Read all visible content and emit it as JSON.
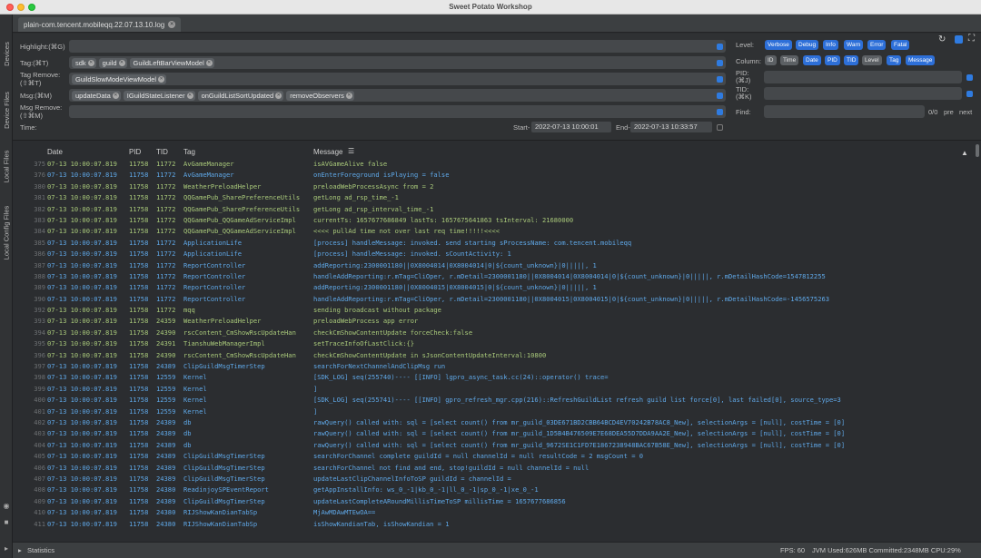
{
  "window": {
    "title": "Sweet Potato Workshop"
  },
  "sidebar": {
    "tabs": [
      "Devices",
      "Device Files",
      "Local Files",
      "Local Config Files"
    ]
  },
  "tab": {
    "label": "plain-com.tencent.mobileqq.22.07.13.10.log"
  },
  "filters": {
    "highlight_label": "Highlight:(⌘G)",
    "tag_label": "Tag:(⌘T)",
    "tag_remove_label": "Tag Remove:\n(⇧⌘T)",
    "msg_label": "Msg:(⌘M)",
    "msg_remove_label": "Msg Remove:\n(⇧⌘M)",
    "time_label": "Time:",
    "tags": [
      "sdk",
      "guild",
      "GuildLeftBarViewModel"
    ],
    "tag_remove": [
      "GuildSlowModeViewModel"
    ],
    "msgs": [
      "updateData",
      "IGuildStateListener",
      "onGuildListSortUpdated",
      "removeObservers"
    ],
    "start_label": "Start-",
    "start_value": "2022-07-13 10:00:01",
    "end_label": "End-",
    "end_value": "2022-07-13 10:33:57"
  },
  "right_panel": {
    "level_label": "Level:",
    "levels": [
      "Verbose",
      "Debug",
      "Info",
      "Warn",
      "Error",
      "Fatal"
    ],
    "column_label": "Column:",
    "columns": [
      "ID",
      "Time",
      "Date",
      "PID",
      "TID",
      "Level",
      "Tag",
      "Message"
    ],
    "pid_label": "PID:\n(⌘J)",
    "tid_label": "TID:\n(⌘K)",
    "find_label": "Find:",
    "find_count": "0/0",
    "prev_label": "pre",
    "next_label": "next"
  },
  "log": {
    "headers": {
      "date": "Date",
      "pid": "PID",
      "tid": "TID",
      "tag": "Tag",
      "message": "Message"
    },
    "rows": [
      {
        "no": "375",
        "date": "07-13 10:00:07.819",
        "pid": "11758",
        "tid": "11772",
        "tag": "AvGameManager",
        "msg": "isAVGameAlive false",
        "lvl": "d"
      },
      {
        "no": "376",
        "date": "07-13 10:00:07.819",
        "pid": "11758",
        "tid": "11772",
        "tag": "AvGameManager",
        "msg": "onEnterForeground isPlaying = false",
        "lvl": "i"
      },
      {
        "no": "380",
        "date": "07-13 10:00:07.819",
        "pid": "11758",
        "tid": "11772",
        "tag": "WeatherPreloadHelper",
        "msg": "preloadWebProcessAsync from = 2",
        "lvl": "d"
      },
      {
        "no": "381",
        "date": "07-13 10:00:07.819",
        "pid": "11758",
        "tid": "11772",
        "tag": "QQGamePub_SharePreferenceUtils",
        "msg": "getLong ad_rsp_time_-1",
        "lvl": "d"
      },
      {
        "no": "382",
        "date": "07-13 10:00:07.819",
        "pid": "11758",
        "tid": "11772",
        "tag": "QQGamePub_SharePreferenceUtils",
        "msg": "getLong ad_rsp_interval_time_-1",
        "lvl": "d"
      },
      {
        "no": "383",
        "date": "07-13 10:00:07.819",
        "pid": "11758",
        "tid": "11772",
        "tag": "QQGamePub_QQGameAdServiceImpl",
        "msg": "currentTs: 1657677686849 lastTs: 1657675641863 tsInterval: 21680000",
        "lvl": "d"
      },
      {
        "no": "384",
        "date": "07-13 10:00:07.819",
        "pid": "11758",
        "tid": "11772",
        "tag": "QQGamePub_QQGameAdServiceImpl",
        "msg": "<<<< pullAd time not over last req time!!!!!<<<<",
        "lvl": "d"
      },
      {
        "no": "385",
        "date": "07-13 10:00:07.819",
        "pid": "11758",
        "tid": "11772",
        "tag": "ApplicationLife",
        "msg": "[process] handleMessage: invoked. send starting sProcessName: com.tencent.mobileqq",
        "lvl": "i"
      },
      {
        "no": "386",
        "date": "07-13 10:00:07.819",
        "pid": "11758",
        "tid": "11772",
        "tag": "ApplicationLife",
        "msg": "[process] handleMessage: invoked.  sCountActivity: 1",
        "lvl": "i"
      },
      {
        "no": "387",
        "date": "07-13 10:00:07.819",
        "pid": "11758",
        "tid": "11772",
        "tag": "ReportController",
        "msg": "addReporting:2300001180||0X8004014|0X8004014|0|${count_unknown}|0|||||, 1",
        "lvl": "i"
      },
      {
        "no": "388",
        "date": "07-13 10:00:07.819",
        "pid": "11758",
        "tid": "11772",
        "tag": "ReportController",
        "msg": "handleAddReporting:r.mTag=CliOper, r.mDetail=2300001180||0X8004014|0X8004014|0|${count_unknown}|0|||||, r.mDetailHashCode=1547812255",
        "lvl": "i"
      },
      {
        "no": "389",
        "date": "07-13 10:00:07.819",
        "pid": "11758",
        "tid": "11772",
        "tag": "ReportController",
        "msg": "addReporting:2300001180||0X8004015|0X8004015|0|${count_unknown}|0|||||, 1",
        "lvl": "i"
      },
      {
        "no": "390",
        "date": "07-13 10:00:07.819",
        "pid": "11758",
        "tid": "11772",
        "tag": "ReportController",
        "msg": "handleAddReporting:r.mTag=CliOper, r.mDetail=2300001180||0X8004015|0X8004015|0|${count_unknown}|0|||||, r.mDetailHashCode=-1456575263",
        "lvl": "i"
      },
      {
        "no": "392",
        "date": "07-13 10:00:07.819",
        "pid": "11758",
        "tid": "11772",
        "tag": "mqq",
        "msg": "sending broadcast without package",
        "lvl": "d"
      },
      {
        "no": "393",
        "date": "07-13 10:00:07.819",
        "pid": "11758",
        "tid": "24359",
        "tag": "WeatherPreloadHelper",
        "msg": "preloadWebProcess app error",
        "lvl": "d"
      },
      {
        "no": "394",
        "date": "07-13 10:00:07.819",
        "pid": "11758",
        "tid": "24390",
        "tag": "rscContent_CmShowRscUpdateHan",
        "msg": "checkCmShowContentUpdate forceCheck:false",
        "lvl": "d"
      },
      {
        "no": "395",
        "date": "07-13 10:00:07.819",
        "pid": "11758",
        "tid": "24391",
        "tag": "TianshuWebManagerImpl",
        "msg": "setTraceInfoOfLastClick:{}",
        "lvl": "d"
      },
      {
        "no": "396",
        "date": "07-13 10:00:07.819",
        "pid": "11758",
        "tid": "24390",
        "tag": "rscContent_CmShowRscUpdateHan",
        "msg": "checkCmShowContentUpdate in sJsonContentUpdateInterval:10800",
        "lvl": "d"
      },
      {
        "no": "397",
        "date": "07-13 10:00:07.819",
        "pid": "11758",
        "tid": "24389",
        "tag": "ClipGuildMsgTimerStep",
        "msg": "searchForNextChannelAndClipMsg run",
        "lvl": "i"
      },
      {
        "no": "398",
        "date": "07-13 10:00:07.819",
        "pid": "11758",
        "tid": "12559",
        "tag": "Kernel",
        "msg": "[SDK_LOG] seq(255740)---- [[INFO] lgpro_async_task.cc(24)::operator() trace=",
        "lvl": "i"
      },
      {
        "no": "399",
        "date": "07-13 10:00:07.819",
        "pid": "11758",
        "tid": "12559",
        "tag": "Kernel",
        "msg": "]",
        "lvl": "i"
      },
      {
        "no": "400",
        "date": "07-13 10:00:07.819",
        "pid": "11758",
        "tid": "12559",
        "tag": "Kernel",
        "msg": "[SDK_LOG] seq(255741)---- [[INFO] gpro_refresh_mgr.cpp(216)::RefreshGuildList refresh guild list force[0], last failed[0], source_type=3",
        "lvl": "i"
      },
      {
        "no": "401",
        "date": "07-13 10:00:07.819",
        "pid": "11758",
        "tid": "12559",
        "tag": "Kernel",
        "msg": "]",
        "lvl": "i"
      },
      {
        "no": "402",
        "date": "07-13 10:00:07.819",
        "pid": "11758",
        "tid": "24389",
        "tag": "db",
        "msg": "rawQuery() called with: sql = [select count() from mr_guild_03DE671BD2CBB64BCD4EV70242B78AC8_New], selectionArgs = [null], costTime = [0]",
        "lvl": "i"
      },
      {
        "no": "403",
        "date": "07-13 10:00:07.819",
        "pid": "11758",
        "tid": "24389",
        "tag": "db",
        "msg": "rawQuery() called with: sql = [select count() from mr_guild_1D5B4B476509E7E68DEA55D7DDA9AA2E_New], selectionArgs = [null], costTime = [0]",
        "lvl": "i"
      },
      {
        "no": "404",
        "date": "07-13 10:00:07.819",
        "pid": "11758",
        "tid": "24389",
        "tag": "db",
        "msg": "rawQuery() called with: sql = [select count() from mr_guild_9672SE1C1FD7E1867238948BAC67B58E_New], selectionArgs = [null], costTime = [0]",
        "lvl": "i"
      },
      {
        "no": "405",
        "date": "07-13 10:00:07.819",
        "pid": "11758",
        "tid": "24389",
        "tag": "ClipGuildMsgTimerStep",
        "msg": "searchForChannel complete guildId = null channelId = null resultCode = 2 msgCount = 0",
        "lvl": "i"
      },
      {
        "no": "406",
        "date": "07-13 10:00:07.819",
        "pid": "11758",
        "tid": "24389",
        "tag": "ClipGuildMsgTimerStep",
        "msg": "searchForChannel not find and end, stop!guildId = null channelId = null",
        "lvl": "i"
      },
      {
        "no": "407",
        "date": "07-13 10:00:07.819",
        "pid": "11758",
        "tid": "24389",
        "tag": "ClipGuildMsgTimerStep",
        "msg": "updateLastClipChannelInfoToSP guildId =  channelId =",
        "lvl": "i"
      },
      {
        "no": "408",
        "date": "07-13 10:00:07.819",
        "pid": "11758",
        "tid": "24380",
        "tag": "ReadinjoySPEventReport",
        "msg": "getAppInstallInfo: ws_0_-1|kb_0_-1|ll_0_-1|sp_0_-1|xe_0_-1",
        "lvl": "i"
      },
      {
        "no": "409",
        "date": "07-13 10:00:07.819",
        "pid": "11758",
        "tid": "24389",
        "tag": "ClipGuildMsgTimerStep",
        "msg": "updateLastCompleteARoundMillisTimeToSP millisTime = 1657677686856",
        "lvl": "i"
      },
      {
        "no": "410",
        "date": "07-13 10:00:07.819",
        "pid": "11758",
        "tid": "24380",
        "tag": "RIJShowKanDianTabSp",
        "msg": "MjAwMDAwMTEwOA==",
        "lvl": "i"
      },
      {
        "no": "411",
        "date": "07-13 10:00:07.819",
        "pid": "11758",
        "tid": "24380",
        "tag": "RIJShowKanDianTabSp",
        "msg": " isShowKandianTab, isShowKandian = 1",
        "lvl": "i"
      }
    ]
  },
  "status": {
    "statistics_label": "Statistics",
    "fps": "FPS: 60",
    "jvm": "JVM Used:626MB Committed:2348MB CPU:29%"
  }
}
